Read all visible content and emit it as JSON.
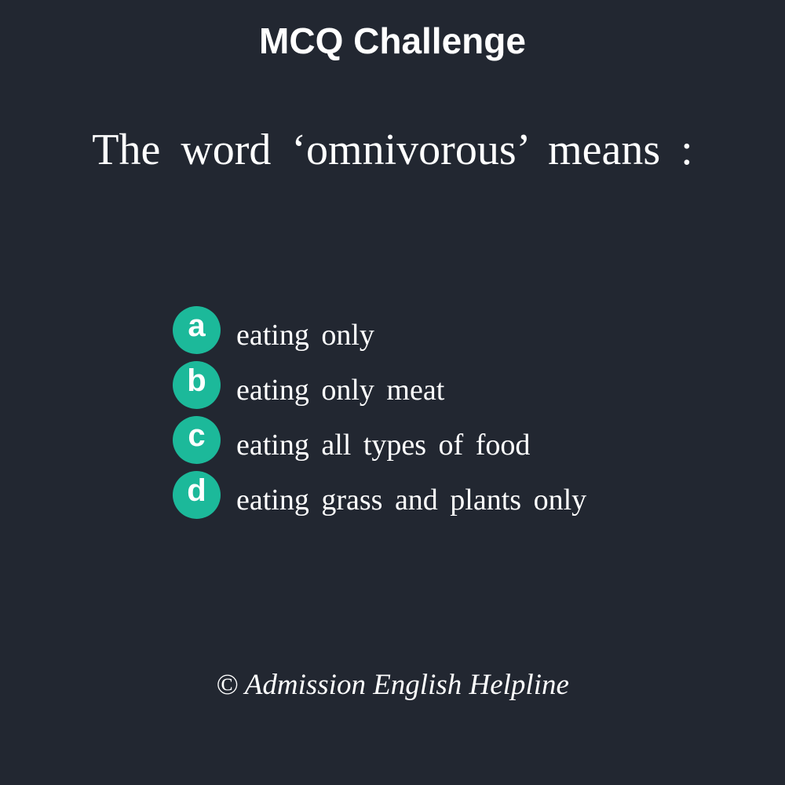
{
  "header": {
    "title": "MCQ Challenge"
  },
  "question": {
    "text": "The word ‘omnivorous’ means :"
  },
  "options": [
    {
      "letter": "a",
      "text": "eating only"
    },
    {
      "letter": "b",
      "text": "eating only meat"
    },
    {
      "letter": "c",
      "text": "eating all types of food"
    },
    {
      "letter": "d",
      "text": "eating grass and plants only"
    }
  ],
  "footer": {
    "credit": "© Admission English Helpline"
  },
  "colors": {
    "background": "#222731",
    "badge": "#1cb99a",
    "text": "#ffffff"
  }
}
